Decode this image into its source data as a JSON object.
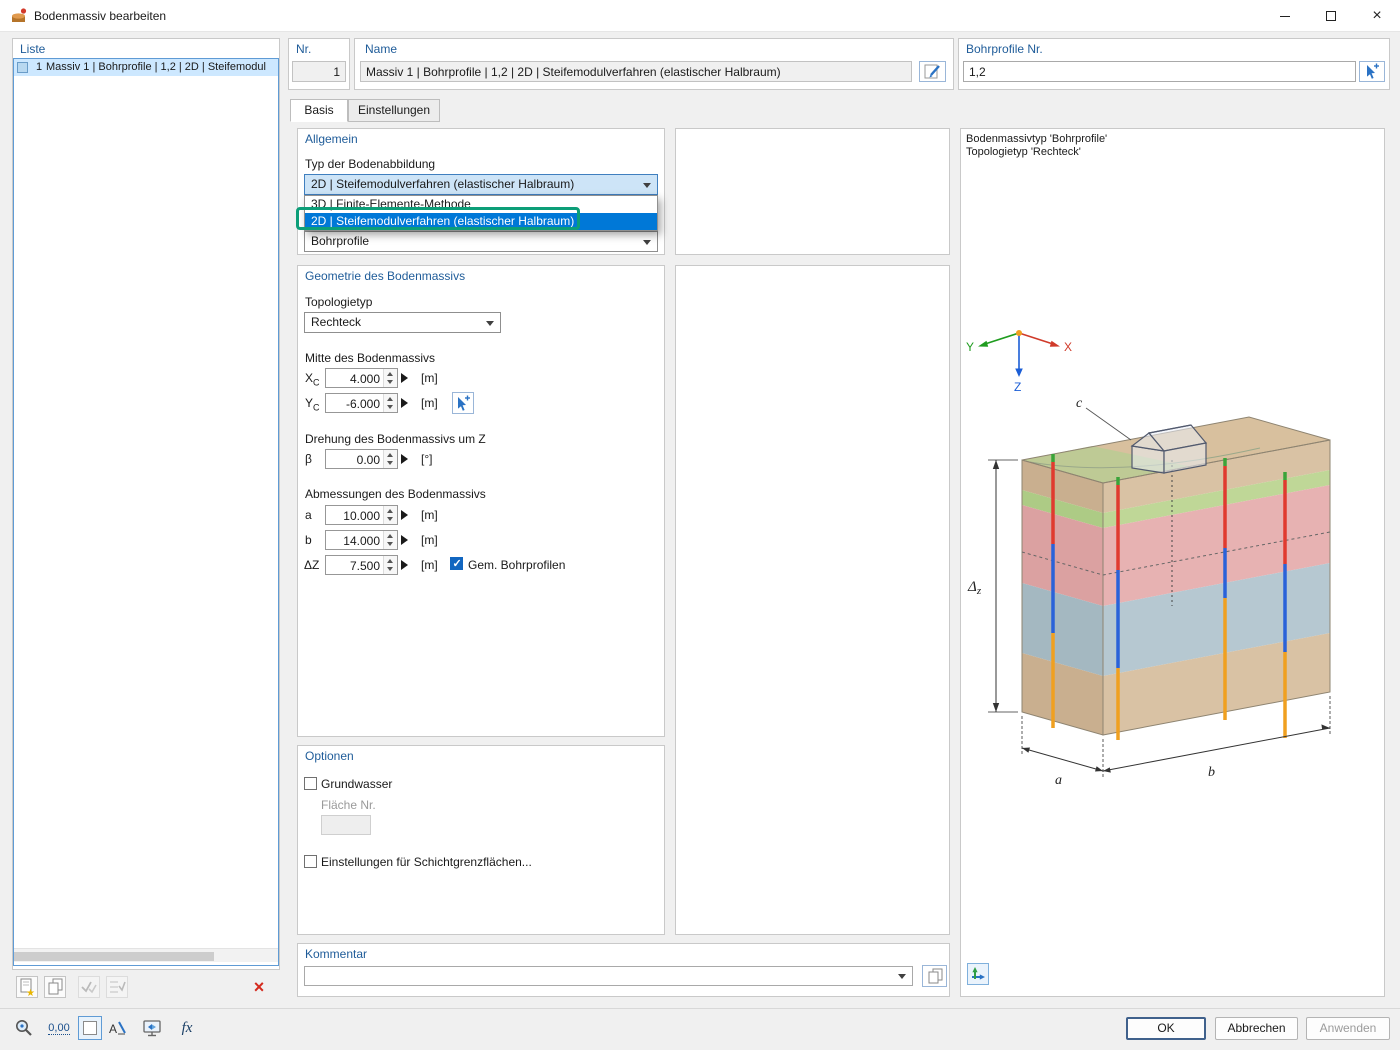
{
  "window": {
    "title": "Bodenmassiv bearbeiten"
  },
  "liste": {
    "label": "Liste",
    "item": {
      "nr": "1",
      "text": "Massiv 1 | Bohrprofile | 1,2 | 2D | Steifemodul"
    }
  },
  "fields": {
    "nr_label": "Nr.",
    "nr_value": "1",
    "name_label": "Name",
    "name_value": "Massiv 1 | Bohrprofile | 1,2 | 2D | Steifemodulverfahren (elastischer Halbraum)",
    "bohrprofile_label": "Bohrprofile Nr.",
    "bohrprofile_value": "1,2"
  },
  "tabs": {
    "basis": "Basis",
    "einstellungen": "Einstellungen"
  },
  "allgemein": {
    "title": "Allgemein",
    "typ_label": "Typ der Bodenabbildung",
    "typ_value": "2D | Steifemodulverfahren (elastischer Halbraum)",
    "options": [
      "3D | Finite-Elemente-Methode",
      "2D | Steifemodulverfahren (elastischer Halbraum)"
    ],
    "methode_value": "Bohrprofile"
  },
  "geometrie": {
    "title": "Geometrie des Bodenmassivs",
    "topologie_label": "Topologietyp",
    "topologie_value": "Rechteck",
    "mitte_label": "Mitte des Bodenmassivs",
    "xc": {
      "sym": "X",
      "sub": "C",
      "value": "4.000",
      "unit": "[m]"
    },
    "yc": {
      "sym": "Y",
      "sub": "C",
      "value": "-6.000",
      "unit": "[m]"
    },
    "drehung_label": "Drehung des Bodenmassivs um Z",
    "beta": {
      "sym": "β",
      "value": "0.00",
      "unit": "[°]"
    },
    "abmessungen_label": "Abmessungen des Bodenmassivs",
    "a": {
      "sym": "a",
      "value": "10.000",
      "unit": "[m]"
    },
    "b": {
      "sym": "b",
      "value": "14.000",
      "unit": "[m]"
    },
    "dz": {
      "sym": "ΔZ",
      "value": "7.500",
      "unit": "[m]"
    },
    "gem_label": "Gem. Bohrprofilen"
  },
  "optionen": {
    "title": "Optionen",
    "grundwasser_label": "Grundwasser",
    "flaeche_label": "Fläche Nr.",
    "flaeche_value": "",
    "schicht_label": "Einstellungen für Schichtgrenzflächen..."
  },
  "kommentar": {
    "title": "Kommentar",
    "value": ""
  },
  "preview": {
    "info1": "Bodenmassivtyp 'Bohrprofile'",
    "info2": "Topologietyp 'Rechteck'",
    "axis_x": "X",
    "axis_y": "Y",
    "axis_z": "Z",
    "dim_a": "a",
    "dim_b": "b",
    "dim_c": "c",
    "dim_dz": "Δ",
    "dim_dz_sub": "z"
  },
  "statusbar": {
    "decimal_label": "0,00",
    "fx_label": "fx"
  },
  "buttons": {
    "ok": "OK",
    "cancel": "Abbrechen",
    "apply": "Anwenden"
  },
  "colors": {
    "accent_blue": "#0078d7",
    "selection_blue": "#cde4f7",
    "annotation_green": "#0c9e78",
    "section_label": "#1f5c99",
    "delete_red": "#d42a1e"
  }
}
